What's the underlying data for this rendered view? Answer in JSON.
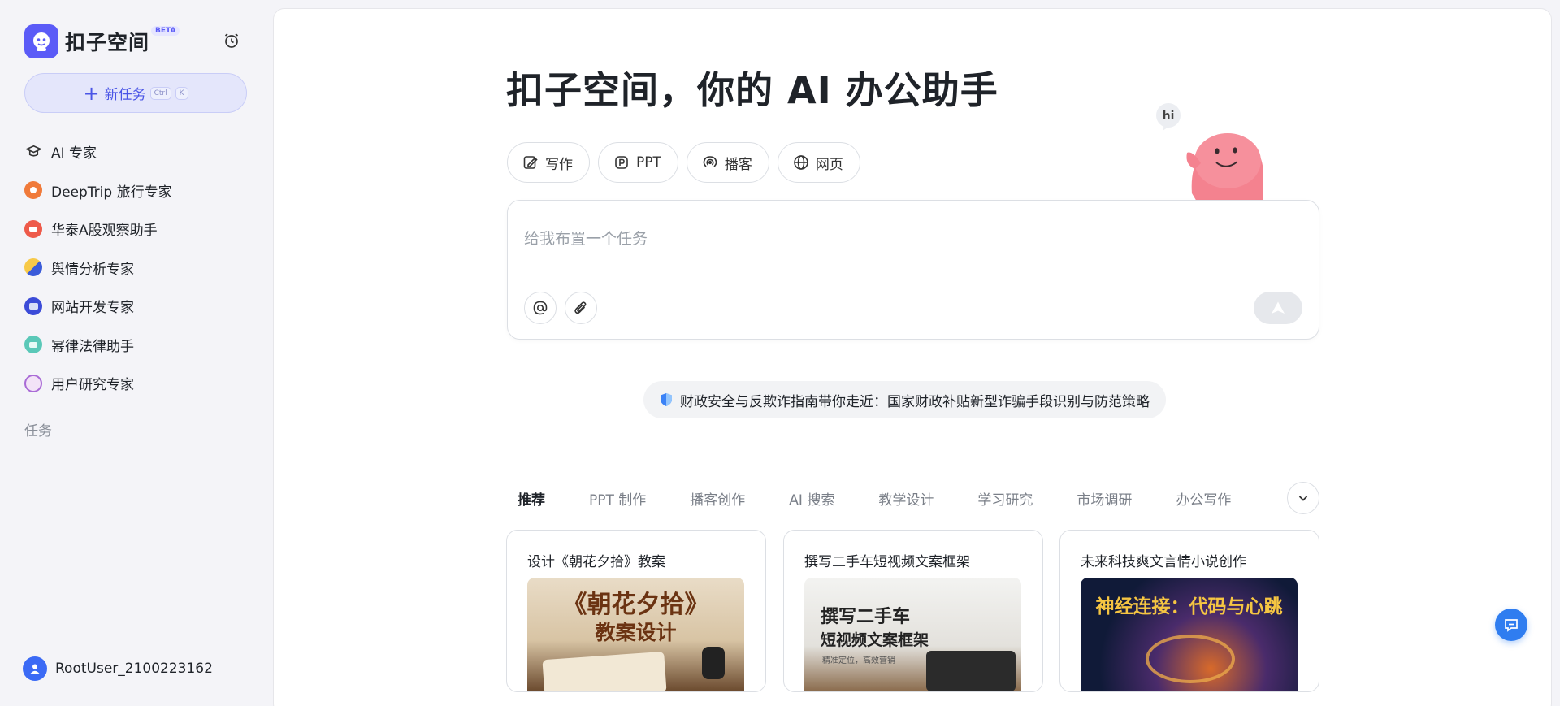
{
  "app": {
    "name": "扣子空间",
    "beta_badge": "BETA"
  },
  "sidebar": {
    "new_task_label": "新任务",
    "shortcut_keys": [
      "Ctrl",
      "K"
    ],
    "items": [
      {
        "label": "AI 专家",
        "icon": "graduation-cap-icon"
      },
      {
        "label": "DeepTrip 旅行专家",
        "icon": "deeptrip-avatar-icon"
      },
      {
        "label": "华泰A股观察助手",
        "icon": "huatai-avatar-icon"
      },
      {
        "label": "舆情分析专家",
        "icon": "sentiment-avatar-icon"
      },
      {
        "label": "网站开发专家",
        "icon": "webdev-avatar-icon"
      },
      {
        "label": "幂律法律助手",
        "icon": "law-avatar-icon"
      },
      {
        "label": "用户研究专家",
        "icon": "research-avatar-icon"
      }
    ],
    "section_title": "任务",
    "user": {
      "name": "RootUser_2100223162"
    }
  },
  "main": {
    "hero_title": "扣子空间，你的 AI 办公助手",
    "chips": [
      {
        "label": "写作",
        "icon": "write-icon"
      },
      {
        "label": "PPT",
        "icon": "ppt-icon"
      },
      {
        "label": "播客",
        "icon": "podcast-icon"
      },
      {
        "label": "网页",
        "icon": "globe-icon"
      }
    ],
    "mascot_bubble": "hi",
    "task_placeholder": "给我布置一个任务",
    "banner_text": "财政安全与反欺诈指南带你走近：国家财政补贴新型诈骗手段识别与防范策略",
    "tabs": [
      "推荐",
      "PPT 制作",
      "播客创作",
      "AI 搜索",
      "教学设计",
      "学习研究",
      "市场调研",
      "办公写作"
    ],
    "active_tab": "推荐",
    "cards": [
      {
        "title": "设计《朝花夕拾》教案",
        "image_line1": "《朝花夕拾》",
        "image_line2": "教案设计",
        "image_line3": ""
      },
      {
        "title": "撰写二手车短视频文案框架",
        "image_line1": "撰写二手车",
        "image_line2": "短视频文案框架",
        "image_line3": "精准定位，高效营销"
      },
      {
        "title": "未来科技爽文言情小说创作",
        "image_line1": "神经连接：代码与心跳",
        "image_line2": "",
        "image_line3": ""
      }
    ]
  },
  "colors": {
    "accent": "#5b5bf7",
    "new_task_bg": "#e4e6fb",
    "chat_fab": "#2f7df0"
  }
}
